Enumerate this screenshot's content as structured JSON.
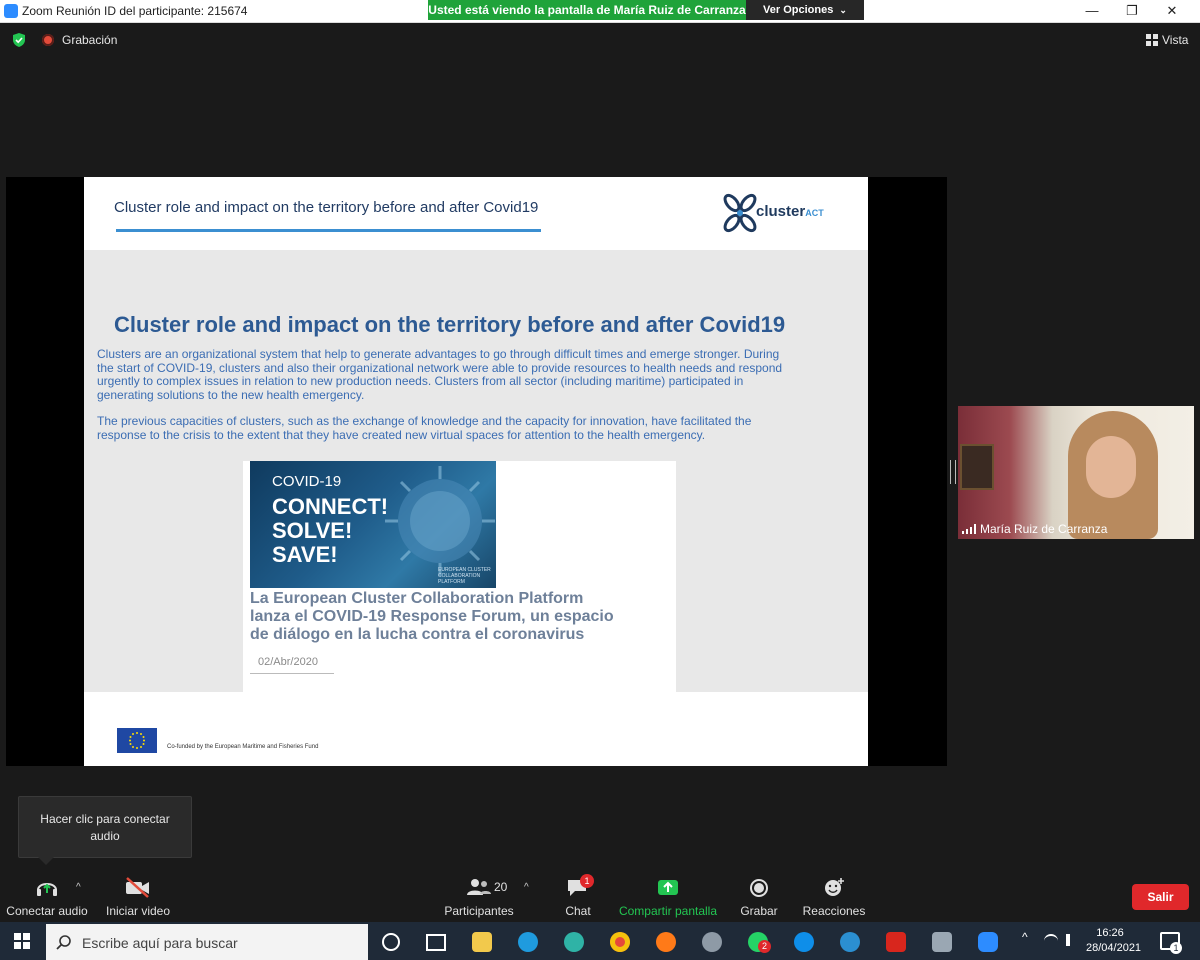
{
  "window": {
    "title": "Zoom Reunión ID del participante: 215674",
    "share_banner": "Usted está viendo la pantalla de María Ruiz de Carranza",
    "view_options": "Ver Opciones",
    "minimize": "—",
    "restore": "❐",
    "close": "✕"
  },
  "status": {
    "recording_label": "Grabación",
    "view_label": "Vista"
  },
  "slide": {
    "header_title": "Cluster role and impact on the territory before and after Covid19",
    "logo_text": "cluster",
    "logo_suffix": "ACT",
    "main_title": "Cluster role and impact on the territory before and after Covid19",
    "paragraph1_lines": [
      "Clusters are an organizational system that help to generate advantages to go through difficult times and emerge stronger. During",
      "the start of COVID-19, clusters and also their organizational network were able to provide resources to health needs and respond",
      "urgently to complex issues in relation to new production needs. Clusters from all sector (including maritime) participated in",
      "generating solutions to the new health emergency."
    ],
    "paragraph2_lines": [
      "The previous capacities of clusters, such as the exchange of knowledge and the capacity for innovation, have facilitated the",
      "response to the crisis to the extent that they have created new virtual spaces for attention to the health emergency."
    ],
    "news": {
      "image_line1": "COVID-19",
      "image_line2": "CONNECT!",
      "image_line3": "SOLVE!",
      "image_line4": "SAVE!",
      "image_caption": "EUROPEAN CLUSTER COLLABORATION PLATFORM",
      "headline_lines": [
        "La European Cluster Collaboration Platform",
        "lanza el COVID-19 Response Forum, un espacio",
        "de diálogo en la lucha contra el coronavirus"
      ],
      "date": "02/Abr/2020"
    },
    "footer_funded": "Co-funded by the European Maritime and Fisheries Fund"
  },
  "participant": {
    "name": "María Ruiz de Carranza"
  },
  "audio_tooltip": {
    "line1": "Hacer clic para conectar",
    "line2": "audio"
  },
  "toolbar": {
    "connect_audio": "Conectar audio",
    "start_video": "Iniciar video",
    "participants": "Participantes",
    "participants_count": "20",
    "chat": "Chat",
    "chat_badge": "1",
    "share_screen": "Compartir pantalla",
    "record": "Grabar",
    "reactions": "Reacciones",
    "leave": "Salir",
    "caret": "^"
  },
  "taskbar": {
    "search_placeholder": "Escribe aquí para buscar",
    "whatsapp_badge": "2",
    "time": "16:26",
    "date": "28/04/2021",
    "notification_count": "1"
  },
  "colors": {
    "share_green": "#1fa33a",
    "leave_red": "#e0282b",
    "slide_title_blue": "#2d5a93",
    "slide_text_blue": "#3b6db3"
  }
}
